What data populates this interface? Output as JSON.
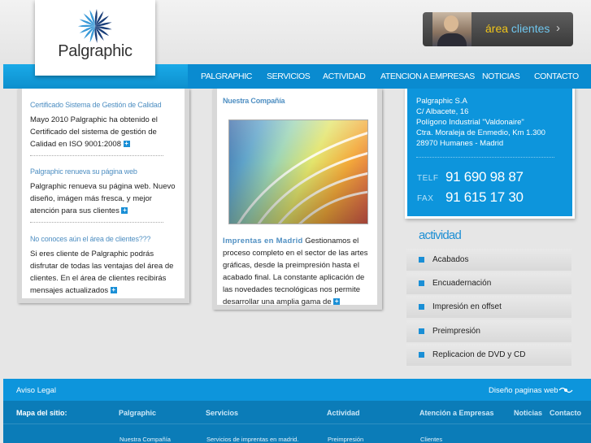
{
  "header": {
    "logo_text": "Palgraphic",
    "client_button": {
      "part1": "área",
      "part2": "clientes",
      "arrow": "›"
    }
  },
  "nav": {
    "items": [
      "PALGRAPHIC",
      "SERVICIOS",
      "ACTIVIDAD",
      "ATENCION A EMPRESAS",
      "NOTICIAS",
      "CONTACTO"
    ]
  },
  "news": [
    {
      "title": "Certificado Sistema de Gestión de Calidad",
      "body": "Mayo 2010 Palgraphic ha obtenido el Certificado del sistema de gestión de Calidad en ISO 9001:2008"
    },
    {
      "title": "Palgraphic renueva su página web",
      "body": "Palgraphic renueva su página web. Nuevo diseño, imágen más fresca, y mejor atención para sus clientes"
    },
    {
      "title": "No conoces aún el área de clientes???",
      "body": "Si eres cliente de Palgraphic podrás disfrutar de todas las ventajas del área de clientes.    En el área de clientes recibirás mensajes actualizados"
    }
  ],
  "company": {
    "title": "Nuestra Compañía",
    "highlight": "Imprentas en Madrid",
    "body": "Gestionamos el proceso completo en el sector de las artes gráficas, desde la preimpresión hasta el acabado final.   La constante aplicación de las novedades tecnológicas nos permite desarrollar una amplia gama de"
  },
  "contact": {
    "lines": [
      "Palgraphic S.A",
      "C/ Albacete, 16",
      "Polígono Industrial \"Valdonaire\"",
      "Ctra. Moraleja de Enmedio, Km 1.300",
      "28970 Humanes - Madrid"
    ],
    "telf_label": "TELF",
    "telf": "91 690 98 87",
    "fax_label": "FAX",
    "fax": "91 615 17 30"
  },
  "actividad": {
    "title": "actividad",
    "items": [
      "Acabados",
      "Encuadernación",
      "Impresión en offset",
      "Preimpresión",
      "Replicacion de DVD y CD"
    ]
  },
  "footer": {
    "aviso": "Aviso Legal",
    "diseno": "Diseño paginas web",
    "mapa": "Mapa del sitio:",
    "columns": [
      "Palgraphic",
      "Servicios",
      "Actividad",
      "Atención a Empresas",
      "Noticias",
      "Contacto"
    ],
    "subs": [
      "Nuestra Compañía",
      "Servicios de imprentas en madrid.",
      "Preimpresión",
      "Clientes"
    ]
  },
  "colors": {
    "accent": "#0d95dc",
    "nav": "#0a8bd0",
    "link": "#4f8fc2"
  }
}
